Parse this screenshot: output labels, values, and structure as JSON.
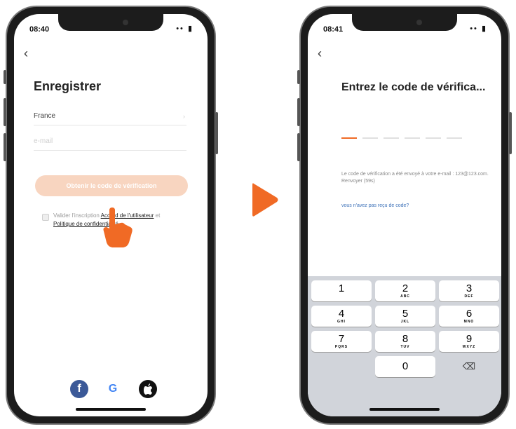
{
  "colors": {
    "accent": "#f06a25",
    "button_disabled": "#f8d5c0",
    "link": "#3a6fb7"
  },
  "left_screen": {
    "status_time": "08:40",
    "status_icons": "•• ▮",
    "back_icon": "‹",
    "title": "Enregistrer",
    "country_value": "France",
    "country_chevron": "›",
    "email_placeholder": "e-mail",
    "get_code_button": "Obtenir le code de vérification",
    "terms": {
      "prefix": "Valider l'inscription",
      "link1": "Accord de l'utilisateur",
      "middle": " et ",
      "link2": "Politique de confidentialité"
    },
    "social": {
      "facebook": "f",
      "google": "G",
      "apple": ""
    }
  },
  "right_screen": {
    "status_time": "08:41",
    "status_icons": "•• ▮",
    "back_icon": "‹",
    "title": "Entrez le code de vérifica...",
    "code_slots": 6,
    "info_text": "Le code de vérification a été envoyé à votre e-mail : 123@123.com. Renvoyer (59s)",
    "no_code_link": "vous n'avez pas reçu de code?",
    "keypad": [
      {
        "num": "1",
        "letters": ""
      },
      {
        "num": "2",
        "letters": "ABC"
      },
      {
        "num": "3",
        "letters": "DEF"
      },
      {
        "num": "4",
        "letters": "GHI"
      },
      {
        "num": "5",
        "letters": "JKL"
      },
      {
        "num": "6",
        "letters": "MNO"
      },
      {
        "num": "7",
        "letters": "PQRS"
      },
      {
        "num": "8",
        "letters": "TUV"
      },
      {
        "num": "9",
        "letters": "WXYZ"
      },
      {
        "num": "0",
        "letters": ""
      }
    ],
    "delete_icon": "⌫"
  }
}
